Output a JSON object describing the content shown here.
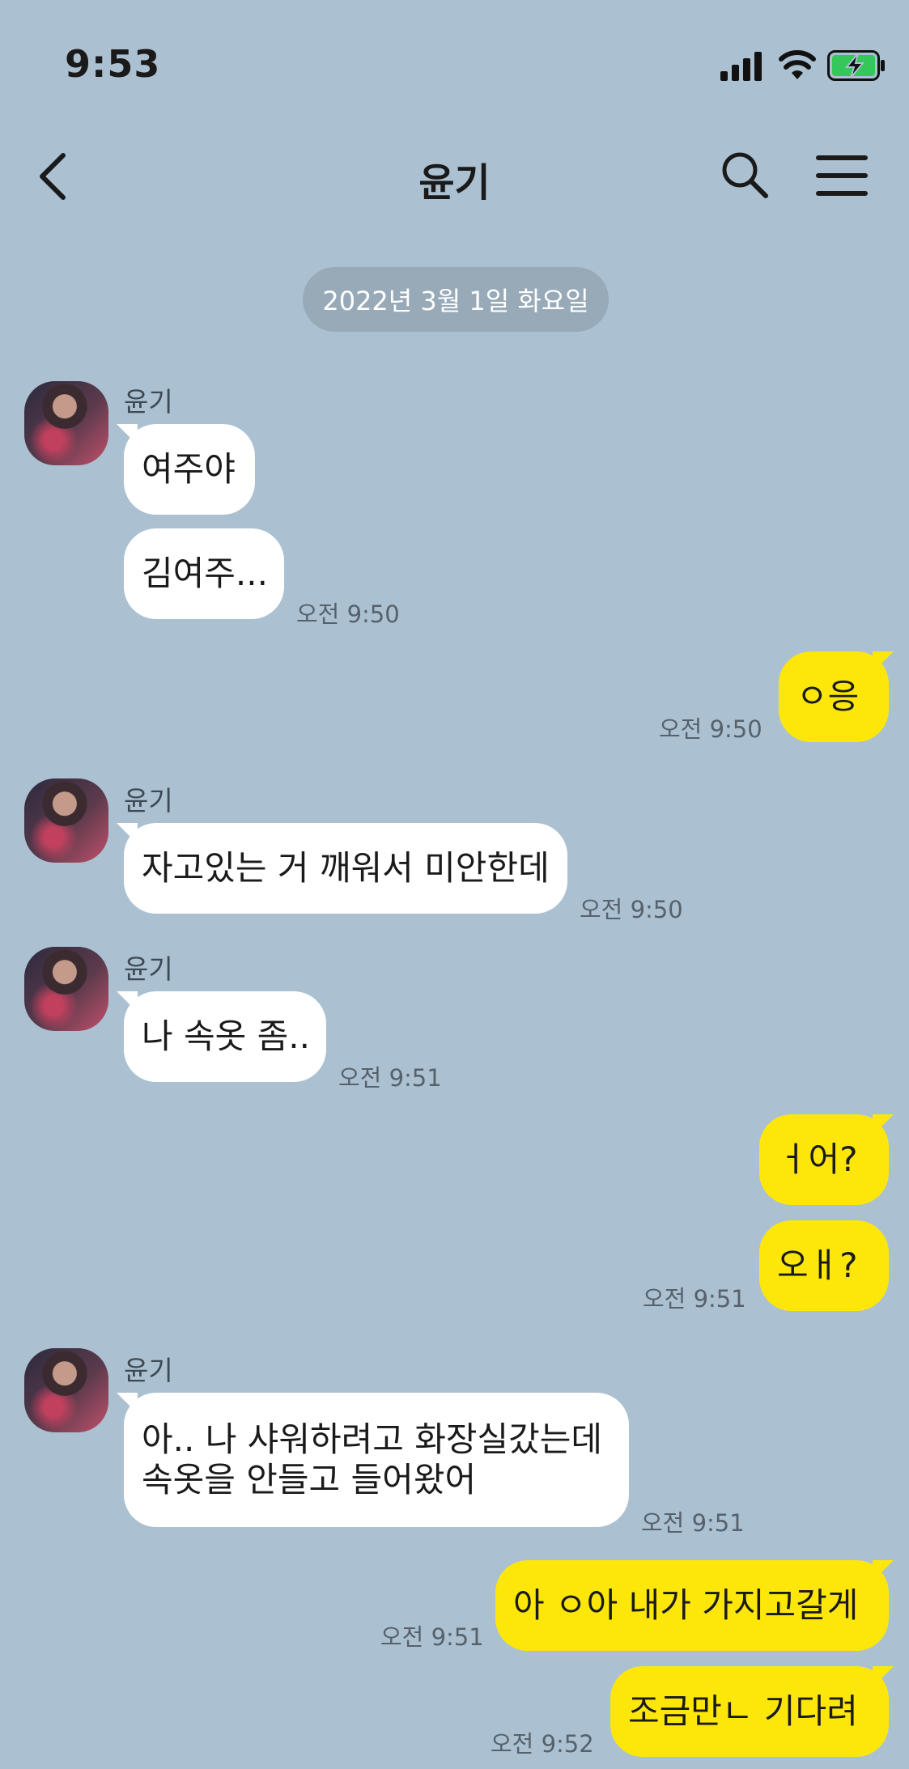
{
  "status_bar": {
    "time": "9:53"
  },
  "header": {
    "title": "윤기"
  },
  "date_divider": "2022년 3월 1일 화요일",
  "colors": {
    "background": "#abc1d1",
    "incoming_bubble": "#ffffff",
    "outgoing_bubble": "#fde70b",
    "date_pill": "#98aab8"
  },
  "messages": [
    {
      "sender": "윤기",
      "text": "여주야"
    },
    {
      "text": "김여주...",
      "time": "오전 9:50"
    },
    {
      "text": "ㅇ응",
      "time": "오전 9:50"
    },
    {
      "sender": "윤기",
      "text": "자고있는 거 깨워서 미안한데",
      "time": "오전 9:50"
    },
    {
      "sender": "윤기",
      "text": "나 속옷 좀..",
      "time": "오전 9:51"
    },
    {
      "text": "ㅓ어?"
    },
    {
      "text": "오ㅐ?",
      "time": "오전 9:51"
    },
    {
      "sender": "윤기",
      "text": "아.. 나 샤워하려고 화장실갔는데 속옷을 안들고 들어왔어",
      "time": "오전 9:51"
    },
    {
      "text": "아 ㅇ아 내가 가지고갈게",
      "time": "오전 9:51"
    },
    {
      "text": "조금만ㄴ 기다려",
      "time": "오전 9:52"
    }
  ]
}
